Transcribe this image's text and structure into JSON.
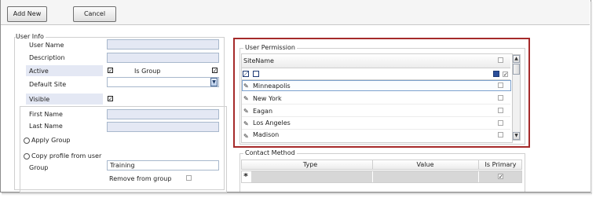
{
  "toolbar": {
    "add_new": "Add New",
    "cancel": "Cancel"
  },
  "user_info": {
    "title": "User Info",
    "user_name_label": "User Name",
    "description_label": "Description",
    "active_label": "Active",
    "active_checked": true,
    "is_group_label": "Is Group",
    "is_group_checked": true,
    "default_site_label": "Default Site",
    "visible_label": "Visible",
    "visible_checked": true,
    "first_name_label": "First Name",
    "last_name_label": "Last Name",
    "apply_group_label": "Apply Group",
    "copy_profile_label": "Copy profile from user",
    "group_label": "Group",
    "group_value": "Training",
    "remove_from_group_label": "Remove from group"
  },
  "user_permission": {
    "title": "User Permission",
    "column_header": "SiteName",
    "rows": [
      {
        "site": "Minneapolis",
        "checked": false,
        "selected": true
      },
      {
        "site": "New York",
        "checked": false
      },
      {
        "site": "Eagan",
        "checked": false
      },
      {
        "site": "Los Angeles",
        "checked": false
      },
      {
        "site": "Madison",
        "checked": false
      }
    ]
  },
  "contact_method": {
    "title": "Contact Method",
    "columns": [
      "Type",
      "Value",
      "Is Primary"
    ],
    "new_row_marker": "*",
    "new_row_is_primary": true
  },
  "glyphs": {
    "check": "✓",
    "pencil": "✎",
    "arrow_up": "▲",
    "arrow_down": "▼",
    "dd_arrow": "▼"
  },
  "colors": {
    "highlight_border": "#a52a2a",
    "field_bg": "#e4e8f4",
    "selected_row_border": "#7da2ce"
  }
}
